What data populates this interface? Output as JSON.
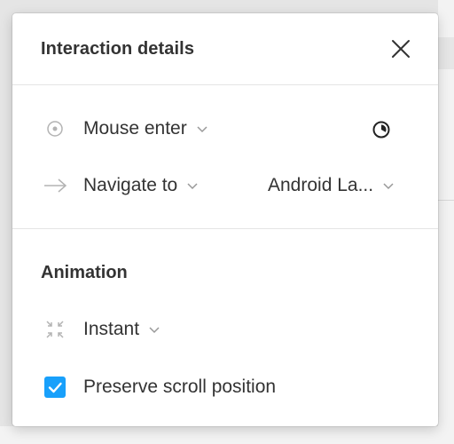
{
  "panel": {
    "title": "Interaction details"
  },
  "interaction": {
    "trigger": {
      "icon": "trigger-circle-icon",
      "selected": "Mouse enter"
    },
    "action": {
      "icon": "arrow-right-icon",
      "selected": "Navigate to",
      "destination": "Android La..."
    },
    "delay_icon": "timer-icon"
  },
  "animation": {
    "heading": "Animation",
    "type": {
      "icon": "instant-collapse-icon",
      "selected": "Instant"
    },
    "preserve_scroll": {
      "checked": true,
      "label": "Preserve scroll position"
    }
  },
  "colors": {
    "checkbox_accent": "#18a0fb",
    "text": "#333333",
    "icon_muted": "#b3b3b3",
    "divider": "#e5e5e5"
  }
}
